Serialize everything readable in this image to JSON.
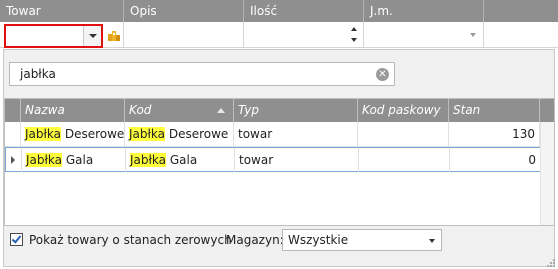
{
  "top_grid": {
    "columns": [
      "Towar",
      "Opis",
      "Ilość",
      "J.m."
    ]
  },
  "popup": {
    "search": {
      "value": "jabłka"
    },
    "list": {
      "columns": [
        "Nazwa",
        "Kod",
        "Typ",
        "Kod paskowy",
        "Stan handlowy"
      ],
      "sorted_column": "Kod",
      "rows": [
        {
          "nazwa_hl": "Jabłka",
          "nazwa_rest": " Deserowe",
          "kod_hl": "Jabłka",
          "kod_rest": " Deserowe",
          "typ": "towar",
          "kod_paskowy": "",
          "stan": "130",
          "selected": false
        },
        {
          "nazwa_hl": "Jabłka",
          "nazwa_rest": " Gala",
          "kod_hl": "Jabłka",
          "kod_rest": " Gala",
          "typ": "towar",
          "kod_paskowy": "",
          "stan": "0",
          "selected": true
        }
      ]
    },
    "footer": {
      "show_zero_label": "Pokaż towary o stanach zerowych",
      "show_zero_checked": true,
      "magazyn_label": "Magazyn:",
      "magazyn_value": "Wszystkie"
    }
  },
  "colors": {
    "header_bg": "#8f8f8f",
    "highlight": "#ffff3c",
    "focus_border": "#e01010",
    "selection_border": "#7aa7d8"
  },
  "icons": [
    "dropdown-icon",
    "warehouse-icon",
    "spin-up-icon",
    "spin-down-icon",
    "clear-icon",
    "sort-ascending-icon",
    "row-indicator-icon",
    "checkbox-icon",
    "resize-grip-icon"
  ]
}
